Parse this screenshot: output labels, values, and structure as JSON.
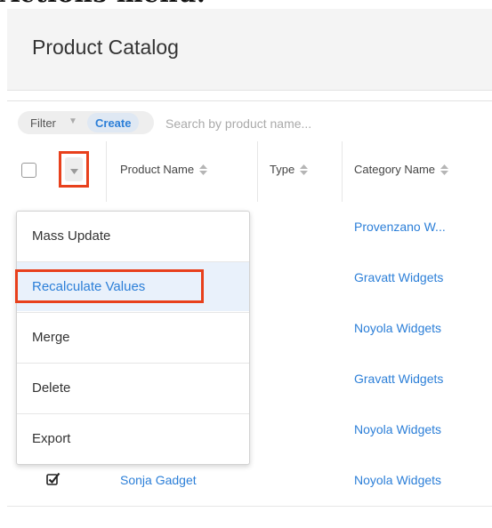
{
  "heading_fragment": "Actions menu.",
  "page": {
    "title": "Product Catalog"
  },
  "filter": {
    "label": "Filter",
    "create_label": "Create",
    "search_placeholder": "Search by product name..."
  },
  "table": {
    "columns": [
      "Product Name",
      "Type",
      "Category Name"
    ],
    "rows": [
      {
        "name": "",
        "category": "Provenzano W...",
        "checked": false
      },
      {
        "name": "",
        "category": "Gravatt Widgets",
        "checked": false
      },
      {
        "name": "",
        "category": "Noyola Widgets",
        "checked": false
      },
      {
        "name": "",
        "category": "Gravatt Widgets",
        "checked": false
      },
      {
        "name": "",
        "category": "Noyola Widgets",
        "checked": false
      },
      {
        "name": "Sonja Gadget",
        "category": "Noyola Widgets",
        "checked": true
      }
    ]
  },
  "actions_menu": {
    "items": [
      "Mass Update",
      "Recalculate Values",
      "Merge",
      "Delete",
      "Export"
    ],
    "highlighted_index": 1
  },
  "colors": {
    "link": "#2c7fd8",
    "highlight_border": "#e8401c",
    "active_item_bg": "#e9f1fb"
  }
}
